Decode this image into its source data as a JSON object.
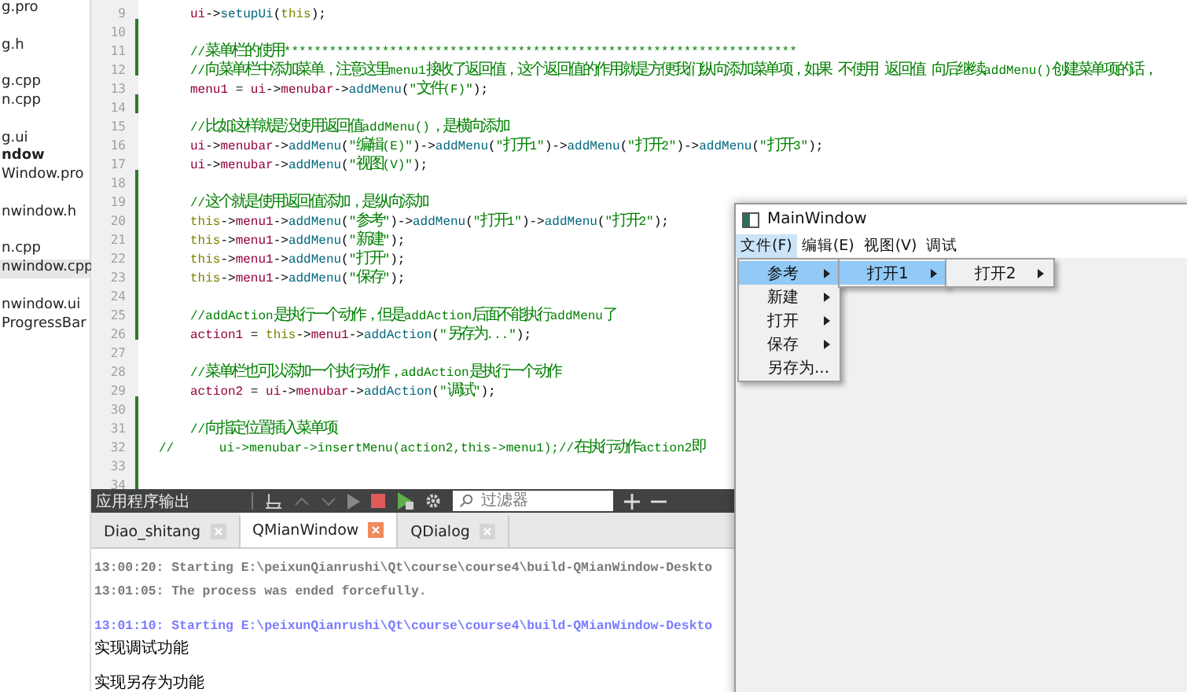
{
  "file_tree": {
    "items": [
      {
        "label": "g.pro",
        "kind": "file",
        "selected": false,
        "gap_before": false
      },
      {
        "label": "g.h",
        "kind": "file",
        "selected": false,
        "gap_before": true
      },
      {
        "label": "g.cpp",
        "kind": "file",
        "selected": false,
        "gap_before": true
      },
      {
        "label": "n.cpp",
        "kind": "file",
        "selected": false,
        "gap_before": false
      },
      {
        "label": "g.ui",
        "kind": "file",
        "selected": false,
        "gap_before": true
      },
      {
        "label": "ndow",
        "kind": "project",
        "selected": false,
        "gap_before": false
      },
      {
        "label": "Window.pro",
        "kind": "file",
        "selected": false,
        "gap_before": false
      },
      {
        "label": "nwindow.h",
        "kind": "file",
        "selected": false,
        "gap_before": true
      },
      {
        "label": "n.cpp",
        "kind": "file",
        "selected": false,
        "gap_before": true
      },
      {
        "label": "nwindow.cpp",
        "kind": "file",
        "selected": true,
        "gap_before": false
      },
      {
        "label": "nwindow.ui",
        "kind": "file",
        "selected": false,
        "gap_before": true
      },
      {
        "label": "ProgressBar",
        "kind": "file",
        "selected": false,
        "gap_before": false
      }
    ]
  },
  "editor": {
    "lines": [
      {
        "number": "9",
        "modified": false,
        "indented": true,
        "tokens": [
          {
            "kind": "var",
            "text": "ui"
          },
          {
            "kind": "op",
            "text": "->"
          },
          {
            "kind": "fn",
            "text": "setupUi"
          },
          {
            "kind": "op",
            "text": "("
          },
          {
            "kind": "kw",
            "text": "this"
          },
          {
            "kind": "op",
            "text": ");"
          }
        ]
      },
      {
        "number": "10",
        "modified": true
      },
      {
        "number": "11",
        "modified": true,
        "indented": true,
        "tokens": [
          {
            "kind": "cmt",
            "text": "//菜单栏的使用********************************************************************"
          }
        ]
      },
      {
        "number": "12",
        "modified": true,
        "indented": true,
        "tokens": [
          {
            "kind": "cmt",
            "text": "//向菜单栏中添加菜单，注意这里menu1接收了返回值，这个返回值的作用就是方便我们纵向添加菜单项，如果 不使用 返回值 向后继续addMenu()创建菜单项的话，"
          }
        ]
      },
      {
        "number": "13",
        "modified": false,
        "indented": true,
        "tokens": [
          {
            "kind": "var",
            "text": "menu1"
          },
          {
            "kind": "op",
            "text": " = "
          },
          {
            "kind": "var",
            "text": "ui"
          },
          {
            "kind": "op",
            "text": "->"
          },
          {
            "kind": "var",
            "text": "menubar"
          },
          {
            "kind": "op",
            "text": "->"
          },
          {
            "kind": "fn",
            "text": "addMenu"
          },
          {
            "kind": "op",
            "text": "("
          },
          {
            "kind": "str",
            "text": "\"文件(F)\""
          },
          {
            "kind": "op",
            "text": ");"
          }
        ]
      },
      {
        "number": "14",
        "modified": true
      },
      {
        "number": "15",
        "modified": false,
        "indented": true,
        "tokens": [
          {
            "kind": "cmt",
            "text": "//比如这样就是没使用返回值addMenu()，是横向添加"
          }
        ]
      },
      {
        "number": "16",
        "modified": false,
        "indented": true,
        "tokens": [
          {
            "kind": "var",
            "text": "ui"
          },
          {
            "kind": "op",
            "text": "->"
          },
          {
            "kind": "var",
            "text": "menubar"
          },
          {
            "kind": "op",
            "text": "->"
          },
          {
            "kind": "fn",
            "text": "addMenu"
          },
          {
            "kind": "op",
            "text": "("
          },
          {
            "kind": "str",
            "text": "\"编辑(E)\""
          },
          {
            "kind": "op",
            "text": ")->"
          },
          {
            "kind": "fn",
            "text": "addMenu"
          },
          {
            "kind": "op",
            "text": "("
          },
          {
            "kind": "str",
            "text": "\"打开1\""
          },
          {
            "kind": "op",
            "text": ")->"
          },
          {
            "kind": "fn",
            "text": "addMenu"
          },
          {
            "kind": "op",
            "text": "("
          },
          {
            "kind": "str",
            "text": "\"打开2\""
          },
          {
            "kind": "op",
            "text": ")->"
          },
          {
            "kind": "fn",
            "text": "addMenu"
          },
          {
            "kind": "op",
            "text": "("
          },
          {
            "kind": "str",
            "text": "\"打开3\""
          },
          {
            "kind": "op",
            "text": ");"
          }
        ]
      },
      {
        "number": "17",
        "modified": false,
        "indented": true,
        "tokens": [
          {
            "kind": "var",
            "text": "ui"
          },
          {
            "kind": "op",
            "text": "->"
          },
          {
            "kind": "var",
            "text": "menubar"
          },
          {
            "kind": "op",
            "text": "->"
          },
          {
            "kind": "fn",
            "text": "addMenu"
          },
          {
            "kind": "op",
            "text": "("
          },
          {
            "kind": "str",
            "text": "\"视图(V)\""
          },
          {
            "kind": "op",
            "text": ");"
          }
        ]
      },
      {
        "number": "18",
        "modified": true
      },
      {
        "number": "19",
        "modified": true,
        "indented": true,
        "tokens": [
          {
            "kind": "cmt",
            "text": "//这个就是使用返回值添加，是纵向添加"
          }
        ]
      },
      {
        "number": "20",
        "modified": true,
        "indented": true,
        "tokens": [
          {
            "kind": "kw",
            "text": "this"
          },
          {
            "kind": "op",
            "text": "->"
          },
          {
            "kind": "var",
            "text": "menu1"
          },
          {
            "kind": "op",
            "text": "->"
          },
          {
            "kind": "fn",
            "text": "addMenu"
          },
          {
            "kind": "op",
            "text": "("
          },
          {
            "kind": "str",
            "text": "\"参考\""
          },
          {
            "kind": "op",
            "text": ")->"
          },
          {
            "kind": "fn",
            "text": "addMenu"
          },
          {
            "kind": "op",
            "text": "("
          },
          {
            "kind": "str",
            "text": "\"打开1\""
          },
          {
            "kind": "op",
            "text": ")->"
          },
          {
            "kind": "fn",
            "text": "addMenu"
          },
          {
            "kind": "op",
            "text": "("
          },
          {
            "kind": "str",
            "text": "\"打开2\""
          },
          {
            "kind": "op",
            "text": ");"
          }
        ]
      },
      {
        "number": "21",
        "modified": true,
        "indented": true,
        "tokens": [
          {
            "kind": "kw",
            "text": "this"
          },
          {
            "kind": "op",
            "text": "->"
          },
          {
            "kind": "var",
            "text": "menu1"
          },
          {
            "kind": "op",
            "text": "->"
          },
          {
            "kind": "fn",
            "text": "addMenu"
          },
          {
            "kind": "op",
            "text": "("
          },
          {
            "kind": "str",
            "text": "\"新建\""
          },
          {
            "kind": "op",
            "text": ");"
          }
        ]
      },
      {
        "number": "22",
        "modified": true,
        "indented": true,
        "tokens": [
          {
            "kind": "kw",
            "text": "this"
          },
          {
            "kind": "op",
            "text": "->"
          },
          {
            "kind": "var",
            "text": "menu1"
          },
          {
            "kind": "op",
            "text": "->"
          },
          {
            "kind": "fn",
            "text": "addMenu"
          },
          {
            "kind": "op",
            "text": "("
          },
          {
            "kind": "str",
            "text": "\"打开\""
          },
          {
            "kind": "op",
            "text": ");"
          }
        ]
      },
      {
        "number": "23",
        "modified": true,
        "indented": true,
        "tokens": [
          {
            "kind": "kw",
            "text": "this"
          },
          {
            "kind": "op",
            "text": "->"
          },
          {
            "kind": "var",
            "text": "menu1"
          },
          {
            "kind": "op",
            "text": "->"
          },
          {
            "kind": "fn",
            "text": "addMenu"
          },
          {
            "kind": "op",
            "text": "("
          },
          {
            "kind": "str",
            "text": "\"保存\""
          },
          {
            "kind": "op",
            "text": ");"
          }
        ]
      },
      {
        "number": "24",
        "modified": true
      },
      {
        "number": "25",
        "modified": true,
        "indented": true,
        "tokens": [
          {
            "kind": "cmt",
            "text": "//addAction是执行一个动作，但是addAction后面不能执行addMenu了"
          }
        ]
      },
      {
        "number": "26",
        "modified": true,
        "indented": true,
        "tokens": [
          {
            "kind": "var",
            "text": "action1"
          },
          {
            "kind": "op",
            "text": " = "
          },
          {
            "kind": "kw",
            "text": "this"
          },
          {
            "kind": "op",
            "text": "->"
          },
          {
            "kind": "var",
            "text": "menu1"
          },
          {
            "kind": "op",
            "text": "->"
          },
          {
            "kind": "fn",
            "text": "addAction"
          },
          {
            "kind": "op",
            "text": "("
          },
          {
            "kind": "str",
            "text": "\"另存为...\""
          },
          {
            "kind": "op",
            "text": ");"
          }
        ]
      },
      {
        "number": "27",
        "modified": false
      },
      {
        "number": "28",
        "modified": false,
        "indented": true,
        "tokens": [
          {
            "kind": "cmt",
            "text": "//菜单栏也可以添加一个执行动作，addAction是执行一个动作"
          }
        ]
      },
      {
        "number": "29",
        "modified": false,
        "indented": true,
        "tokens": [
          {
            "kind": "var",
            "text": "action2"
          },
          {
            "kind": "op",
            "text": " = "
          },
          {
            "kind": "var",
            "text": "ui"
          },
          {
            "kind": "op",
            "text": "->"
          },
          {
            "kind": "var",
            "text": "menubar"
          },
          {
            "kind": "op",
            "text": "->"
          },
          {
            "kind": "fn",
            "text": "addAction"
          },
          {
            "kind": "op",
            "text": "("
          },
          {
            "kind": "str",
            "text": "\"调试\""
          },
          {
            "kind": "op",
            "text": ");"
          }
        ]
      },
      {
        "number": "30",
        "modified": true
      },
      {
        "number": "31",
        "modified": true,
        "indented": true,
        "tokens": [
          {
            "kind": "cmt",
            "text": "//向指定位置插入菜单项"
          }
        ]
      },
      {
        "number": "32",
        "modified": true,
        "indented": false,
        "tokens": [
          {
            "kind": "cmt",
            "text": "//      ui->menubar->insertMenu(action2,this->menu1);//在执行动作action2即"
          }
        ]
      },
      {
        "number": "33",
        "modified": true
      },
      {
        "number": "34",
        "modified": true
      }
    ]
  },
  "output_pane": {
    "title": "应用程序输出",
    "filter": {
      "placeholder": "过滤器"
    },
    "tabs": [
      {
        "label": "Diao_shitang",
        "selected": false
      },
      {
        "label": "QMianWindow",
        "selected": true
      },
      {
        "label": "QDialog",
        "selected": false
      }
    ],
    "lines": [
      {
        "kind": "info",
        "gap_before": false,
        "text": "13:00:20: Starting E:\\peixunQianrushi\\Qt\\course\\course4\\build-QMianWindow-Deskto"
      },
      {
        "kind": "info",
        "gap_before": false,
        "text": "13:01:05: The process was ended forcefully."
      },
      {
        "kind": "start",
        "gap_before": true,
        "text": "13:01:10: Starting E:\\peixunQianrushi\\Qt\\course\\course4\\build-QMianWindow-Deskto"
      },
      {
        "kind": "program",
        "gap_before": false,
        "text": "实现调试功能"
      },
      {
        "kind": "program",
        "gap_before": true,
        "text": "实现另存为功能"
      }
    ]
  },
  "main_window": {
    "title": "MainWindow",
    "menubar": [
      {
        "label": "文件(F)",
        "selected": true,
        "children": [
          {
            "label": "参考",
            "selected": true,
            "submenu": true,
            "children": [
              {
                "label": "打开1",
                "selected": true,
                "submenu": true,
                "children": [
                  {
                    "label": "打开2",
                    "selected": false,
                    "submenu": true
                  }
                ]
              }
            ]
          },
          {
            "label": "新建",
            "selected": false,
            "submenu": true
          },
          {
            "label": "打开",
            "selected": false,
            "submenu": true
          },
          {
            "label": "保存",
            "selected": false,
            "submenu": true
          },
          {
            "label": "另存为...",
            "selected": false,
            "submenu": false
          }
        ]
      },
      {
        "label": "编辑(E)",
        "selected": false
      },
      {
        "label": "视图(V)",
        "selected": false
      },
      {
        "label": "调试",
        "selected": false
      }
    ]
  }
}
